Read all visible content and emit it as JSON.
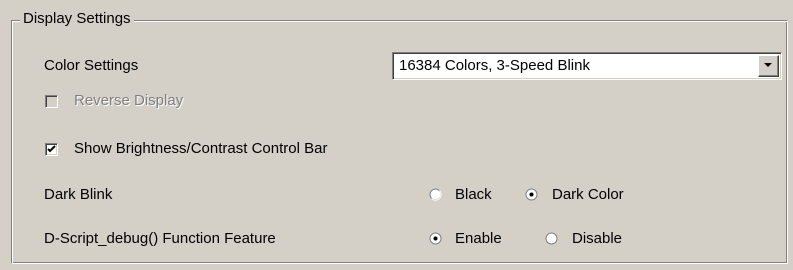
{
  "group": {
    "title": "Display Settings"
  },
  "color_settings": {
    "label": "Color Settings",
    "selected": "16384 Colors, 3-Speed Blink"
  },
  "reverse_display": {
    "label": "Reverse Display",
    "checked": false,
    "enabled": false
  },
  "brightness_bar": {
    "label": "Show Brightness/Contrast Control Bar",
    "checked": true
  },
  "dark_blink": {
    "label": "Dark Blink",
    "options": [
      "Black",
      "Dark Color"
    ],
    "selected": "Dark Color"
  },
  "dscript_debug": {
    "label": "D-Script_debug() Function Feature",
    "options": [
      "Enable",
      "Disable"
    ],
    "selected": "Enable"
  },
  "colors": {
    "face": "#d4d0c8",
    "shadow": "#808080",
    "highlight": "#ffffff"
  }
}
